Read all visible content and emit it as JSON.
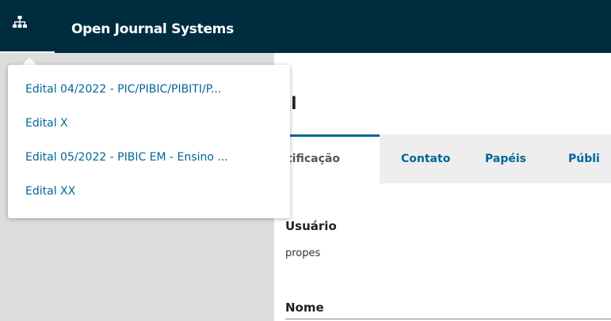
{
  "header": {
    "app_title": "Open Journal Systems",
    "sites_icon": "sitemap-icon"
  },
  "site_menu": {
    "items": [
      "Edital 04/2022 - PIC/PIBIC/PIBITI/P...",
      "Edital X",
      "Edital 05/2022 - PIBIC EM - Ensino ...",
      "Edital XX"
    ]
  },
  "main": {
    "page_title": "il",
    "tabs": [
      {
        "label": "ntificação",
        "active": true
      },
      {
        "label": "Contato"
      },
      {
        "label": "Papéis"
      },
      {
        "label": "Públi"
      }
    ],
    "fields": {
      "username_label": "Usuário",
      "username_value": "propes",
      "name_label": "Nome"
    }
  },
  "colors": {
    "topbar": "#002c40",
    "link": "#006798",
    "sidebar": "#dddddd"
  }
}
